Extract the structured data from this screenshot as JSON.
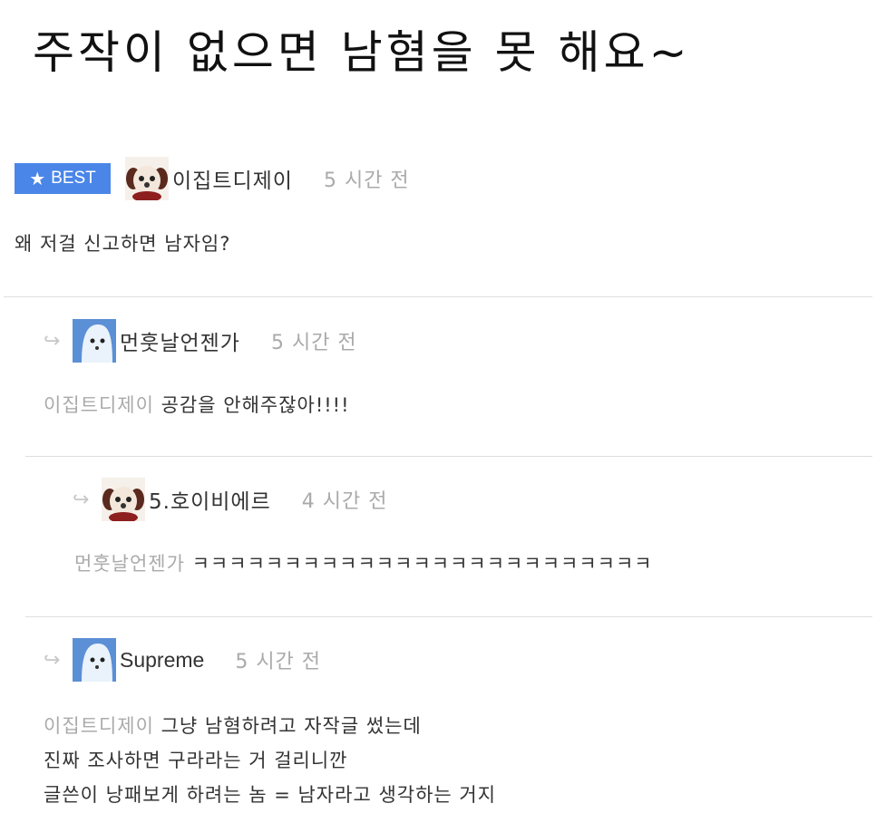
{
  "headline": "주작이 없으면 남혐을 못 해요~",
  "best_badge": {
    "icon": "star-icon",
    "label": "BEST"
  },
  "colors": {
    "best_badge_bg": "#4a86e8",
    "muted_text": "#aaaaaa",
    "divider": "#dedede"
  },
  "comments": [
    {
      "nickname": "이집트디제이",
      "time": "5 시간 전",
      "avatar_icon": "dog-avatar-icon",
      "lines": [
        {
          "mention": "",
          "text": "왜 저걸 신고하면 남자임?"
        }
      ]
    },
    {
      "nickname": "먼훗날언젠가",
      "time": "5 시간 전",
      "avatar_icon": "ghost-avatar-icon",
      "reply_icon": "reply-arrow-icon",
      "lines": [
        {
          "mention": "이집트디제이",
          "text": "공감을 안해주잖아!!!!"
        }
      ]
    },
    {
      "nickname": "5.호이비에르",
      "time": "4 시간 전",
      "avatar_icon": "dog-avatar-icon",
      "reply_icon": "reply-arrow-icon",
      "lines": [
        {
          "mention": "먼훗날언젠가",
          "text": "ㅋㅋㅋㅋㅋㅋㅋㅋㅋㅋㅋㅋㅋㅋㅋㅋㅋㅋㅋㅋㅋㅋㅋㅋㅋ"
        }
      ]
    },
    {
      "nickname": "Supreme",
      "time": "5 시간 전",
      "avatar_icon": "ghost-avatar-icon",
      "reply_icon": "reply-arrow-icon",
      "lines": [
        {
          "mention": "이집트디제이",
          "text": "그냥 남혐하려고 자작글 썼는데"
        },
        {
          "mention": "",
          "text": "진짜 조사하면 구라라는 거 걸리니깐"
        },
        {
          "mention": "",
          "text": "글쓴이 낭패보게 하려는 놈 = 남자라고 생각하는 거지"
        }
      ]
    }
  ]
}
